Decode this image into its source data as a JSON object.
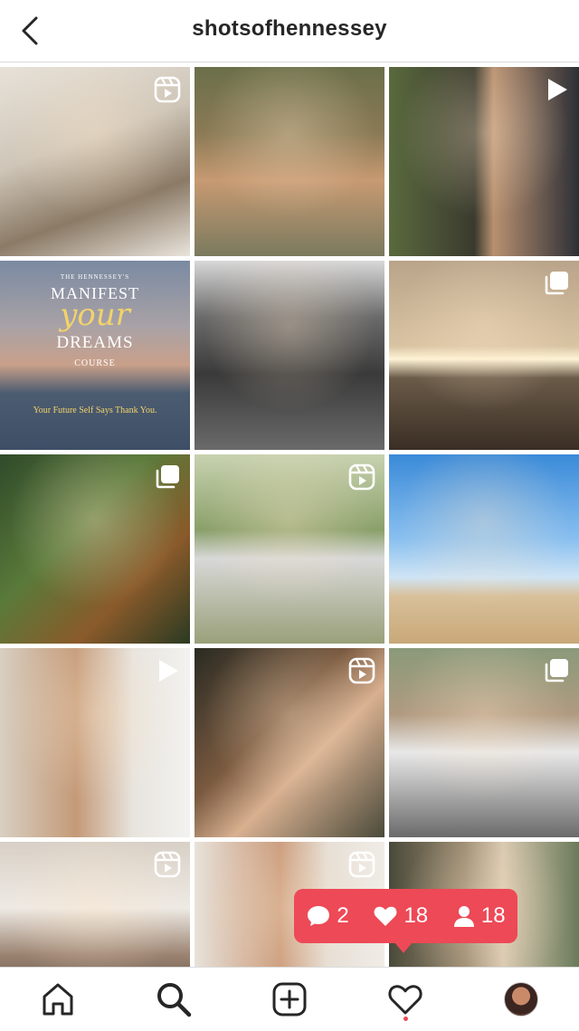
{
  "header": {
    "username": "shotsofhennessey"
  },
  "colors": {
    "accent": "#ed4956",
    "divider": "#dbdbdb"
  },
  "grid": {
    "tiles": [
      {
        "name": "post-1",
        "badge": "reels-icon",
        "bg": "linear-gradient(160deg,#e7e2d9 0%,#cfc6b8 40%,#8b7a66 70%,#e9e4dc 100%)"
      },
      {
        "name": "post-2",
        "badge": "",
        "bg": "linear-gradient(180deg,#6b6f4a 0%,#8a7a55 35%,#c79a72 60%,#7a7a5e 100%)"
      },
      {
        "name": "post-3",
        "badge": "play-icon",
        "bg": "linear-gradient(90deg,#5a6a3e 0%,#3a3a2e 45%,#b89070 55%,#2c2f36 100%)"
      },
      {
        "name": "post-4",
        "badge": "",
        "bg": "linear-gradient(180deg,#7a8aa2 0%,#a9a2a6 35%,#c9a08a 55%,#4c5c70 70%,#3e4e66 100%)"
      },
      {
        "name": "post-5",
        "badge": "",
        "bg": "linear-gradient(180deg,#d8d8d8 0%,#6a6a6a 30%,#3a3a3a 60%,#6a6a6a 100%)"
      },
      {
        "name": "post-6",
        "badge": "carousel-icon",
        "bg": "linear-gradient(180deg,#b9a48a 0%,#d8c3a2 45%,#fff4d6 52%,#6a5a48 62%,#3a2e24 100%)"
      },
      {
        "name": "post-7",
        "badge": "carousel-icon",
        "bg": "linear-gradient(135deg,#2f4a2a 0%,#5a7a3a 40%,#8a5a2a 70%,#2a3a22 100%)"
      },
      {
        "name": "post-8",
        "badge": "reels-icon",
        "bg": "linear-gradient(180deg,#c8d2b0 0%,#8aa06a 40%,#d8d8d8 55%,#9aa07a 100%)"
      },
      {
        "name": "post-9",
        "badge": "",
        "bg": "linear-gradient(180deg,#3a8ad8 0%,#8ac0f0 45%,#cfe4f4 65%,#d8c09a 75%,#c8a878 100%)"
      },
      {
        "name": "post-10",
        "badge": "play-icon",
        "bg": "linear-gradient(90deg,#d8cfc2 0%,#c49a78 40%,#e8e4de 70%,#f2f2f0 100%)"
      },
      {
        "name": "post-11",
        "badge": "reels-icon",
        "bg": "linear-gradient(135deg,#2a2a22 0%,#7a5a40 40%,#d8b090 60%,#4a4a3a 100%)"
      },
      {
        "name": "post-12",
        "badge": "carousel-icon",
        "bg": "linear-gradient(180deg,#8a9a7a 0%,#b09a80 35%,#e8e8e8 55%,#6a6a6a 100%)"
      },
      {
        "name": "post-13",
        "badge": "reels-icon",
        "bg": "linear-gradient(180deg,#d8d0c6 0%,#eeeae4 35%,#9a8270 60%,#2a2a2a 100%)"
      },
      {
        "name": "post-14",
        "badge": "reels-icon",
        "bg": "linear-gradient(90deg,#e8e2da 0%,#c89878 45%,#e6dfd6 70%,#f0ece6 100%)"
      },
      {
        "name": "post-15",
        "badge": "",
        "bg": "linear-gradient(90deg,#4a4a3a 0%,#9a8a70 40%,#d8c8b0 60%,#6a7a5a 100%)"
      }
    ]
  },
  "manifest_post": {
    "presenter": "THE HENNESSEY'S",
    "line1": "MANIFEST",
    "script": "your",
    "line2": "DREAMS",
    "course": "COURSE",
    "tagline": "Your Future Self Says Thank You."
  },
  "activity": {
    "comments": "2",
    "likes": "18",
    "follows": "18"
  },
  "nav": [
    "home-icon",
    "search-icon",
    "new-post-icon",
    "activity-heart-icon",
    "profile-avatar"
  ]
}
